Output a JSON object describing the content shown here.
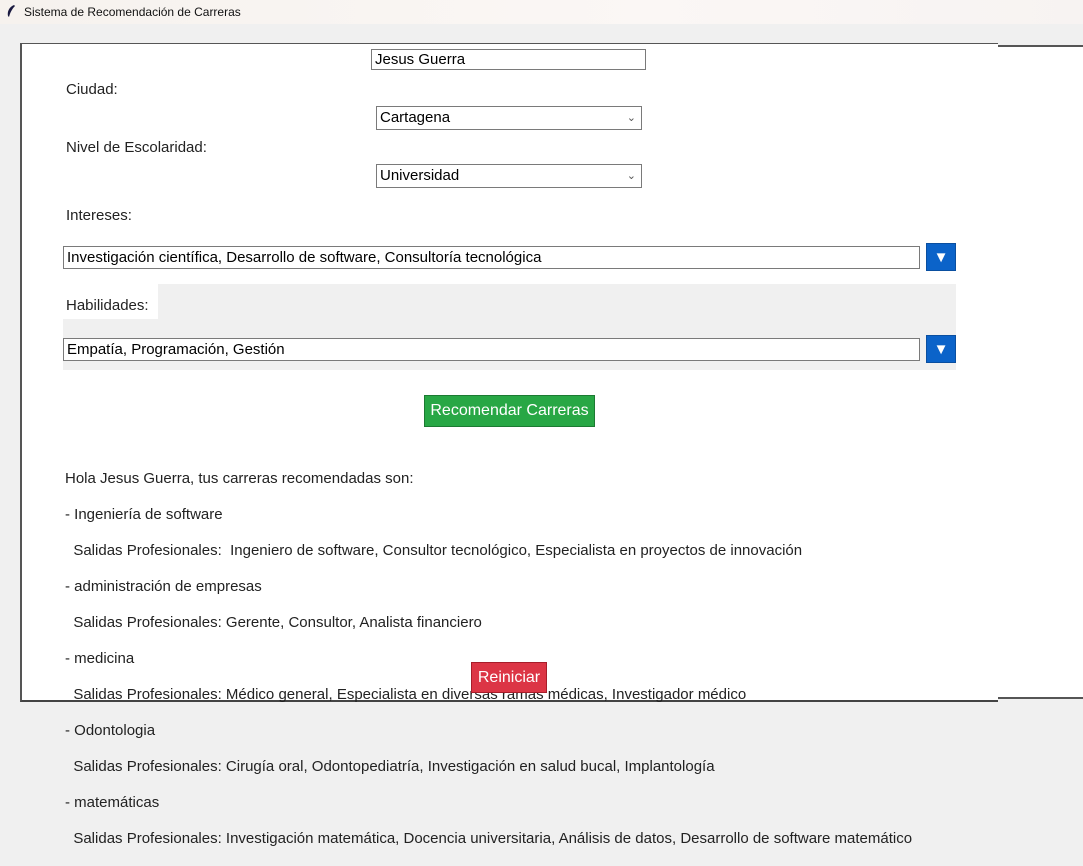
{
  "window": {
    "title": "Sistema de Recomendación de Carreras"
  },
  "form": {
    "name_value": "Jesus Guerra",
    "city_label": "Ciudad:",
    "city_value": "Cartagena",
    "school_label": "Nivel de Escolaridad:",
    "school_value": "Universidad",
    "interests_label": "Intereses:",
    "interests_value": "Investigación científica, Desarrollo de software, Consultoría tecnológica",
    "skills_label": "Habilidades:",
    "skills_value": "Empatía,   Programación, Gestión",
    "dropdown_glyph": "▼",
    "combo_chevron": "⌄"
  },
  "actions": {
    "recommend_label": "Recomendar Carreras",
    "reset_label": "Reiniciar"
  },
  "results": {
    "greeting": "Hola Jesus Guerra, tus carreras recomendadas son:",
    "careers": [
      {
        "name": "- Ingeniería de software",
        "outlets": "  Salidas Profesionales:  Ingeniero de software, Consultor tecnológico, Especialista en proyectos de innovación"
      },
      {
        "name": "- administración de empresas",
        "outlets": "  Salidas Profesionales: Gerente, Consultor, Analista financiero"
      },
      {
        "name": "- medicina",
        "outlets": "  Salidas Profesionales: Médico general, Especialista en diversas ramas médicas, Investigador médico"
      },
      {
        "name": "- Odontologia",
        "outlets": "  Salidas Profesionales: Cirugía oral, Odontopediatría, Investigación en salud bucal, Implantología"
      },
      {
        "name": "- matemáticas",
        "outlets": "  Salidas Profesionales: Investigación matemática, Docencia universitaria, Análisis de datos, Desarrollo de software matemático"
      }
    ]
  },
  "colors": {
    "recommend_button": "#28a745",
    "reset_button": "#dc3545",
    "dropdown_button": "#0b63c9"
  }
}
